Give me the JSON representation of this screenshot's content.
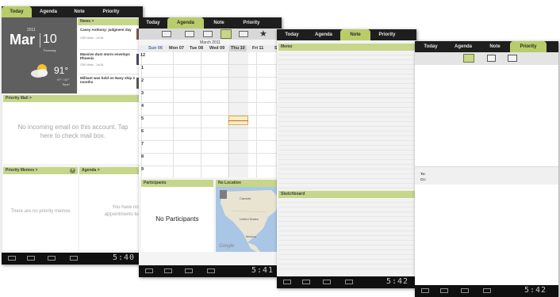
{
  "today_screen": {
    "tabs": [
      "Today",
      "Agenda",
      "Note",
      "Priority"
    ],
    "date": {
      "year": "2011",
      "month": "Mar",
      "day": "10",
      "weekday": "Thursday"
    },
    "weather": {
      "temp": "91°",
      "range": "97° / 87°",
      "city": "Tepe!"
    },
    "news": {
      "title": "News",
      "items": [
        {
          "headline": "Casey Anthony: judgment day",
          "source": "CBS News - Jul 06"
        },
        {
          "headline": "Massive dust storm envelops Phoenix",
          "source": "CBS News - Jul 06"
        },
        {
          "headline": "Militant was held on Navy ship 2 months",
          "source": ""
        }
      ]
    },
    "priority_mail": {
      "title": "Priority Mail",
      "message": "No incoming email on this account. Tap here to check mail box."
    },
    "priority_memos": {
      "title": "Priority Memos",
      "message": "There are no priority memos"
    },
    "agenda": {
      "title": "Agenda",
      "message": "You have no appointments today"
    },
    "clock": "5:40"
  },
  "agenda_screen": {
    "tabs": [
      "Today",
      "Agenda",
      "Note",
      "Priority"
    ],
    "month": "March 2011",
    "days": [
      "Sun 06",
      "Mon 07",
      "Tue 08",
      "Wed 09",
      "Thu 10",
      "Fri 11",
      "S"
    ],
    "hours": [
      "12",
      "1",
      "2",
      "3",
      "4",
      "5",
      "6",
      "7",
      "8",
      "9"
    ],
    "participants": {
      "title": "Participants",
      "message": "No Participants"
    },
    "location": {
      "title": "No Location",
      "map_labels": [
        "Canada",
        "United States",
        "Mexico"
      ],
      "watermark": "Google"
    },
    "clock": "5:41"
  },
  "note_screen": {
    "tabs": [
      "Today",
      "Agenda",
      "Note",
      "Priority"
    ],
    "memo_title": "Memo",
    "sketchboard_title": "Sketchboard",
    "clock": "5:42"
  },
  "priority_screen": {
    "tabs": [
      "Today",
      "Agenda",
      "Note",
      "Priority"
    ],
    "to_label": "To:",
    "cc_label": "Cc:",
    "clock": "5:42"
  },
  "colors": {
    "accent": "#b9cc6a",
    "header": "#c6d68a",
    "tabbar": "#1e1e1e",
    "navbar": "#101010",
    "selection": "#f7efc0"
  }
}
